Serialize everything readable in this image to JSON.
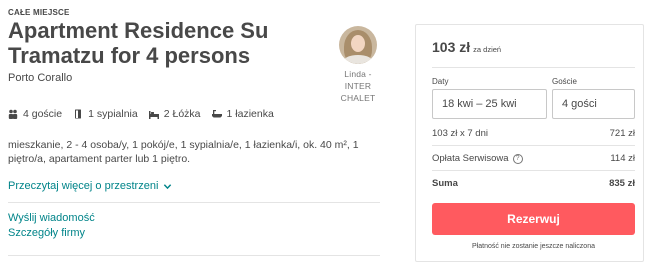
{
  "listing": {
    "overline": "CAŁE MIEJSCE",
    "title": "Apartment Residence Su Tramatzu for 4 persons",
    "location": "Porto Corallo"
  },
  "host": {
    "name": "Linda - INTER CHALET"
  },
  "amenities": [
    {
      "icon": "guests-icon",
      "label": "4 goście"
    },
    {
      "icon": "bedroom-icon",
      "label": "1 sypialnia"
    },
    {
      "icon": "bed-icon",
      "label": "2 Łóżka"
    },
    {
      "icon": "bathroom-icon",
      "label": "1 łazienka"
    }
  ],
  "description": "mieszkanie, 2 - 4 osoba/y, 1 pokój/e, 1 sypialnia/e, 1 łazienka/i, ok. 40 m², 1 piętro/a, apartament parter lub 1 piętro.",
  "links": {
    "read_more": "Przeczytaj więcej o przestrzeni",
    "send_message": "Wyślij wiadomość",
    "company_details": "Szczegóły firmy"
  },
  "booking": {
    "price": "103 zł",
    "price_unit": "za dzień",
    "dates_label": "Daty",
    "dates_value": "18 kwi – 25 kwi",
    "guests_label": "Goście",
    "guests_value": "4 gości",
    "line_nights_label": "103 zł x 7 dni",
    "line_nights_value": "721 zł",
    "service_fee_label": "Opłata Serwisowa",
    "service_fee_value": "114 zł",
    "total_label": "Suma",
    "total_value": "835 zł",
    "reserve_button": "Rezerwuj",
    "note": "Płatność nie zostanie jeszcze naliczona"
  },
  "colors": {
    "link": "#008489",
    "primary_button": "#ff5a5f",
    "text": "#484848"
  }
}
